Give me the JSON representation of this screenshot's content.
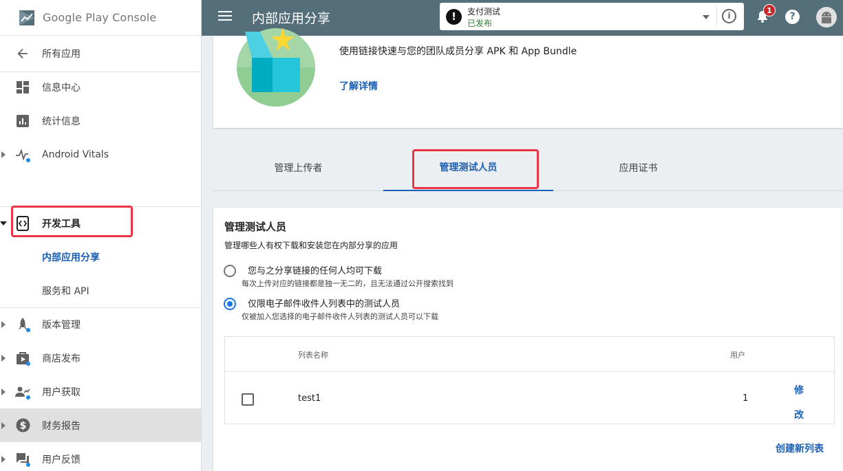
{
  "brand": {
    "name": "Google Play Console"
  },
  "sidebar": {
    "items": [
      {
        "label": "所有应用",
        "icon": "arrow-left-icon"
      },
      {
        "label": "信息中心",
        "icon": "dashboard-icon"
      },
      {
        "label": "统计信息",
        "icon": "bar-chart-icon"
      },
      {
        "label": "Android Vitals",
        "icon": "pulse-icon"
      },
      {
        "label": "开发工具",
        "icon": "dev-tools-icon"
      },
      {
        "label": "内部应用分享"
      },
      {
        "label": "服务和 API"
      },
      {
        "label": "版本管理",
        "icon": "rocket-icon"
      },
      {
        "label": "商店发布",
        "icon": "store-icon"
      },
      {
        "label": "用户获取",
        "icon": "users-icon"
      },
      {
        "label": "财务报告",
        "icon": "dollar-icon"
      },
      {
        "label": "用户反馈",
        "icon": "feedback-icon"
      }
    ]
  },
  "header": {
    "title": "内部应用分享",
    "app": {
      "name": "支付测试",
      "status": "已发布"
    },
    "notifications": "1",
    "help": "?",
    "info": "i"
  },
  "hero": {
    "description": "使用链接快速与您的团队成员分享 APK 和 App Bundle",
    "learn_more": "了解详情"
  },
  "tabs": [
    "管理上传者",
    "管理测试人员",
    "应用证书"
  ],
  "testers": {
    "title": "管理测试人员",
    "subtitle": "管理哪些人有权下载和安装您在内部分享的应用",
    "options": [
      {
        "label": "您与之分享链接的任何人均可下载",
        "hint": "每次上传对应的链接都是独一无二的，且无法通过公开搜索找到"
      },
      {
        "label": "仅限电子邮件收件人列表中的测试人员",
        "hint": "仅被加入您选择的电子邮件收件人列表的测试人员可以下载"
      }
    ],
    "table": {
      "headers": [
        "列表名称",
        "用户"
      ],
      "rows": [
        {
          "name": "test1",
          "users": "1",
          "action": "修改"
        }
      ]
    },
    "create_list": "创建新列表"
  },
  "colors": {
    "header_bg": "#546e7a",
    "accent": "#1a5fb4",
    "highlight_box": "#ea3344",
    "published": "#2e7d32"
  }
}
